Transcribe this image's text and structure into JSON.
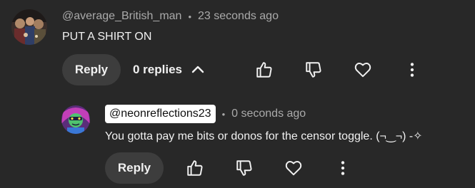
{
  "comment": {
    "author": "@average_British_man",
    "separator": "•",
    "timestamp": "23 seconds ago",
    "text": "PUT A SHIRT ON",
    "reply_label": "Reply",
    "replies_label": "0 replies",
    "icons": [
      "like-icon",
      "dislike-icon",
      "heart-icon",
      "more-vertical-icon",
      "chevron-up-icon"
    ]
  },
  "reply": {
    "author": "@neonreflections23",
    "separator": "•",
    "timestamp": "0 seconds ago",
    "text": "You gotta pay me bits or donos for the censor toggle. (¬‿¬) -✧",
    "reply_label": "Reply",
    "icons": [
      "like-icon",
      "dislike-icon",
      "heart-icon",
      "more-vertical-icon"
    ]
  },
  "colors": {
    "background": "#282828",
    "primary_text": "#f1f1f1",
    "secondary_text": "#aaaaaa",
    "button_bg": "#3d3d3d",
    "handle_pill_bg": "#ffffff"
  }
}
